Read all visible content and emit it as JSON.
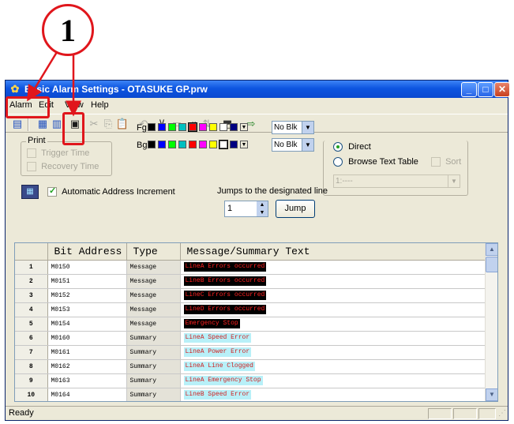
{
  "callout": {
    "number": "1"
  },
  "window": {
    "title": "Basic Alarm Settings - OTASUKE GP.prw",
    "minimize": "_",
    "maximize": "□",
    "close": "✕"
  },
  "menu": [
    "Alarm",
    "Edit",
    "View",
    "Help"
  ],
  "print": {
    "legend": "Print",
    "trigger_time": "Trigger Time",
    "recovery_time": "Recovery Time"
  },
  "colors": {
    "fg_label": "Fg",
    "bg_label": "Bg",
    "fg_blink": "No Blk",
    "bg_blink": "No Blk",
    "palette": [
      "#000000",
      "#0000ff",
      "#00ff00",
      "#00c0c0",
      "#ff0000",
      "#ff00ff",
      "#ffff00",
      "#ffffff",
      "#000080"
    ]
  },
  "auto_increment": {
    "label": "Automatic Address Increment",
    "checked": true
  },
  "jump": {
    "label": "Jumps to the designated line",
    "value": "1",
    "button": "Jump"
  },
  "mode": {
    "direct": "Direct",
    "browse": "Browse Text Table",
    "sort": "Sort",
    "table_value": "1:----"
  },
  "table": {
    "headers": [
      "",
      "Bit Address",
      "Type",
      "Message/Summary Text"
    ],
    "rows": [
      {
        "num": "1",
        "addr": "M0150",
        "type": "Message",
        "text": "LineA Errors occurred",
        "fg": "#ff2020",
        "bg": "#000000"
      },
      {
        "num": "2",
        "addr": "M0151",
        "type": "Message",
        "text": "LineB Errors occurred",
        "fg": "#ff2020",
        "bg": "#000000"
      },
      {
        "num": "3",
        "addr": "M0152",
        "type": "Message",
        "text": "LineC Errors occurred",
        "fg": "#ff2020",
        "bg": "#000000"
      },
      {
        "num": "4",
        "addr": "M0153",
        "type": "Message",
        "text": "LineD Errors occurred",
        "fg": "#ff2020",
        "bg": "#000000"
      },
      {
        "num": "5",
        "addr": "M0154",
        "type": "Message",
        "text": "Emergency Stop",
        "fg": "#ff2020",
        "bg": "#000000"
      },
      {
        "num": "6",
        "addr": "M0160",
        "type": "Summary",
        "text": "LineA Speed Error",
        "fg": "#d02020",
        "bg": "#b8f0f8"
      },
      {
        "num": "7",
        "addr": "M0161",
        "type": "Summary",
        "text": "LineA Power Error",
        "fg": "#d02020",
        "bg": "#b8f0f8"
      },
      {
        "num": "8",
        "addr": "M0162",
        "type": "Summary",
        "text": "LineA Line Clogged",
        "fg": "#d02020",
        "bg": "#b8f0f8"
      },
      {
        "num": "9",
        "addr": "M0163",
        "type": "Summary",
        "text": "LineA Emergency Stop",
        "fg": "#d02020",
        "bg": "#b8f0f8"
      },
      {
        "num": "10",
        "addr": "M0164",
        "type": "Summary",
        "text": "LineB Speed Error",
        "fg": "#d02020",
        "bg": "#b8f0f8"
      }
    ]
  },
  "status": {
    "text": "Ready"
  }
}
